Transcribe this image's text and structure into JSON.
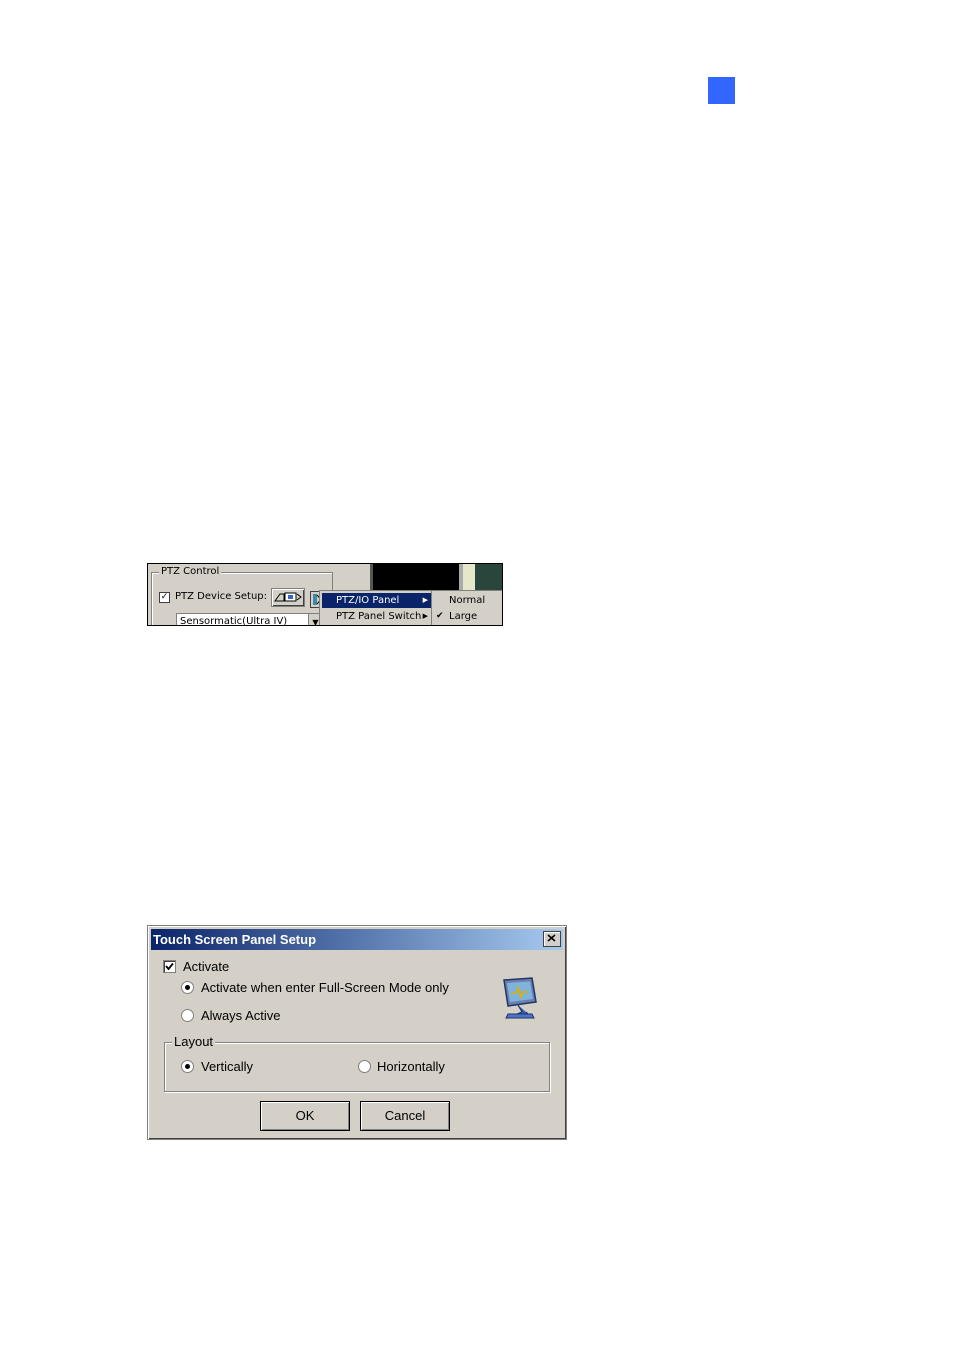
{
  "page": {
    "marker_color": "#3366ff"
  },
  "ptz_panel": {
    "group_title": "PTZ Control",
    "device_setup_label": "PTZ Device Setup:",
    "device_setup_checked": true,
    "selected_device": "Sensormatic(Ultra IV)",
    "context_menu": [
      {
        "label": "PTZ/IO Panel",
        "highlighted": true
      },
      {
        "label": "PTZ Panel Switch",
        "highlighted": false
      }
    ],
    "submenu": [
      {
        "label": "Normal",
        "checked": false
      },
      {
        "label": "Large",
        "checked": true
      }
    ]
  },
  "dialog": {
    "title": "Touch Screen Panel Setup",
    "activate_label": "Activate",
    "activate_checked": true,
    "mode_options": [
      {
        "label": "Activate when enter Full-Screen Mode only",
        "selected": true
      },
      {
        "label": "Always Active",
        "selected": false
      }
    ],
    "layout": {
      "title": "Layout",
      "options": [
        {
          "label": "Vertically",
          "selected": true
        },
        {
          "label": "Horizontally",
          "selected": false
        }
      ]
    },
    "ok_label": "OK",
    "cancel_label": "Cancel",
    "titlebar_color": "#0a246a"
  }
}
